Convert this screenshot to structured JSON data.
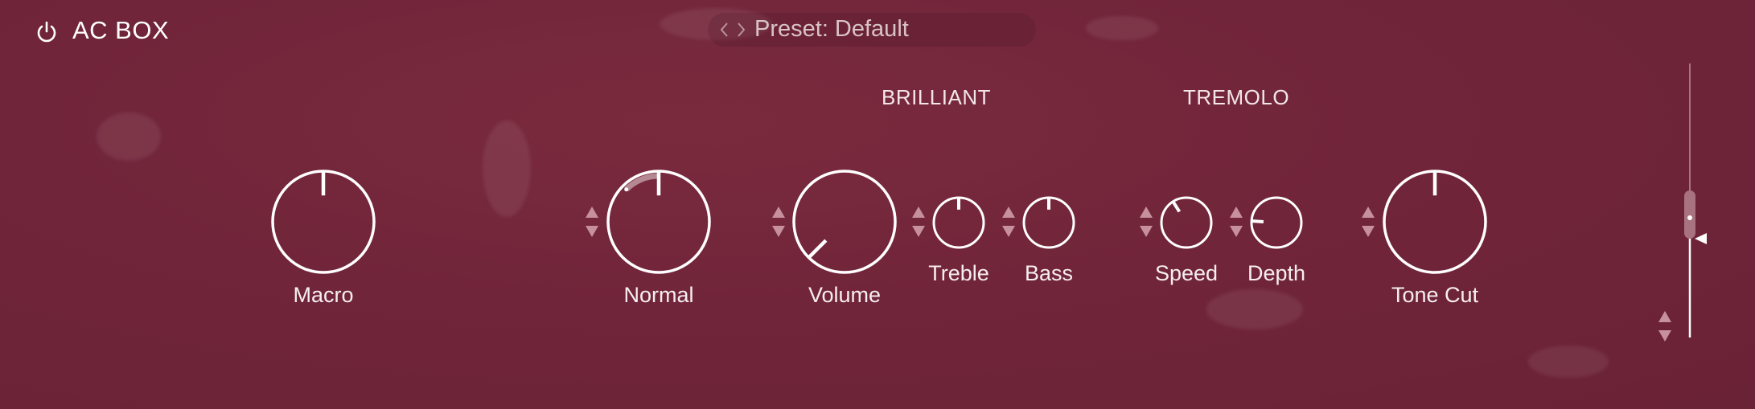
{
  "header": {
    "title": "AC BOX",
    "preset_label": "Preset: Default",
    "icons": {
      "power": "power-icon",
      "prev": "chevron-left-icon",
      "next": "chevron-right-icon"
    }
  },
  "sections": {
    "brilliant": "BRILLIANT",
    "tremolo": "TREMOLO"
  },
  "knobs": {
    "macro": {
      "label": "Macro",
      "value": 0.5
    },
    "normal": {
      "label": "Normal",
      "value": 0.5
    },
    "volume": {
      "label": "Volume",
      "value": 0.0
    },
    "treble": {
      "label": "Treble",
      "value": 0.5
    },
    "bass": {
      "label": "Bass",
      "value": 0.5
    },
    "speed": {
      "label": "Speed",
      "value": 0.38
    },
    "depth": {
      "label": "Depth",
      "value": 0.18
    },
    "tone_cut": {
      "label": "Tone Cut",
      "value": 0.5
    }
  },
  "output_slider": {
    "value": 0.55
  },
  "colors": {
    "background": "#71253a",
    "knob_stroke": "#ffffff",
    "arrow": "#c6909c",
    "preset_text": "#d9c3c8"
  }
}
